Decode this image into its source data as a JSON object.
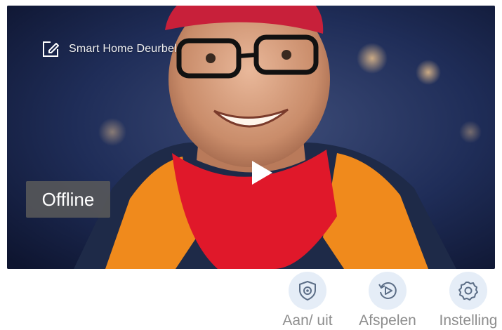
{
  "camera": {
    "device_name": "Smart Home Deurbel",
    "status": "Offline"
  },
  "icons": {
    "edit": "edit-icon",
    "play": "play-icon",
    "power": "shield-power-icon",
    "playback": "replay-icon",
    "settings": "gear-icon"
  },
  "toolbar": {
    "power_label": "Aan/ uit",
    "playback_label": "Afspelen",
    "settings_label": "Instelling"
  },
  "colors": {
    "icon_bg": "#e5edf7",
    "icon_stroke": "#5b6d86",
    "label": "#8d8d8d",
    "badge_bg": "#5a5a5a"
  }
}
